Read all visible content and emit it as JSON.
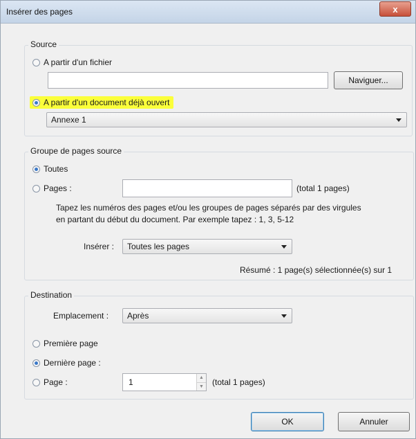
{
  "window": {
    "title": "Insérer des pages",
    "close": "x"
  },
  "source": {
    "legend": "Source",
    "from_file_label": "A partir d'un fichier",
    "file_value": "",
    "browse_label": "Naviguer...",
    "from_open_doc_label": "A partir d'un document déjà ouvert",
    "open_doc_selected": "Annexe 1"
  },
  "page_group": {
    "legend": "Groupe de pages source",
    "all_label": "Toutes",
    "pages_label": "Pages :",
    "pages_value": "",
    "total": "(total 1 pages)",
    "help_line1": "Tapez les numéros des pages et/ou les groupes de pages séparés par des virgules",
    "help_line2": "en partant du début du document. Par exemple tapez : 1, 3, 5-12",
    "insert_label": "Insérer :",
    "insert_selected": "Toutes les pages",
    "summary": "Résumé : 1 page(s) sélectionnée(s) sur 1"
  },
  "destination": {
    "legend": "Destination",
    "location_label": "Emplacement :",
    "location_selected": "Après",
    "first_page_label": "Première page",
    "last_page_label": "Dernière page :",
    "page_label": "Page :",
    "page_value": "1",
    "total": "(total 1 pages)"
  },
  "buttons": {
    "ok": "OK",
    "cancel": "Annuler"
  }
}
